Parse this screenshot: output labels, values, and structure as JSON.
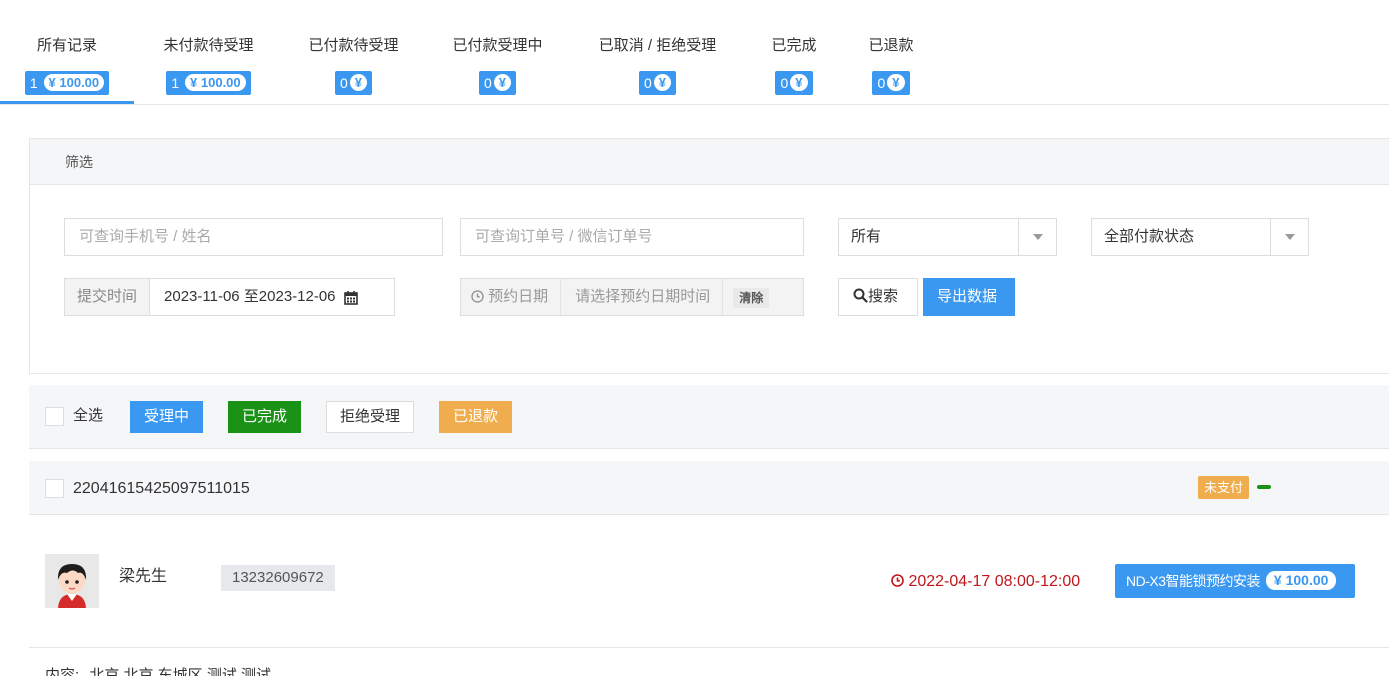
{
  "tabs": [
    {
      "label": "所有记录",
      "count": "1",
      "amount": "¥ 100.00",
      "active": true
    },
    {
      "label": "未付款待受理",
      "count": "1",
      "amount": "¥ 100.00",
      "active": false
    },
    {
      "label": "已付款待受理",
      "count": "0",
      "amount": "¥",
      "active": false
    },
    {
      "label": "已付款受理中",
      "count": "0",
      "amount": "¥",
      "active": false
    },
    {
      "label": "已取消 / 拒绝受理",
      "count": "0",
      "amount": "¥",
      "active": false
    },
    {
      "label": "已完成",
      "count": "0",
      "amount": "¥",
      "active": false
    },
    {
      "label": "已退款",
      "count": "0",
      "amount": "¥",
      "active": false
    }
  ],
  "filter": {
    "title": "筛选",
    "phone_placeholder": "可查询手机号 / 姓名",
    "order_placeholder": "可查询订单号 / 微信订单号",
    "select_all": "所有",
    "select_pay": "全部付款状态",
    "submit_time_label": "提交时间",
    "submit_time_value": "2023-11-06 至2023-12-06",
    "appoint_label": "预约日期",
    "appoint_placeholder": "请选择预约日期时间",
    "clear": "清除",
    "search": "搜索",
    "export": "导出数据"
  },
  "batch": {
    "select_all": "全选",
    "processing": "受理中",
    "done": "已完成",
    "reject": "拒绝受理",
    "refunded": "已退款"
  },
  "order": {
    "id": "22041615425097511015",
    "status": "未支付",
    "name": "梁先生",
    "phone": "13232609672",
    "appoint_time": "2022-04-17 08:00-12:00",
    "product": "ND-X3智能锁预约安装",
    "price": "¥ 100.00",
    "address_label": "内容:",
    "address": "北京 北京 东城区 测试 测试"
  },
  "colors": {
    "primary": "#3a98f0",
    "success": "#1a9216",
    "warning": "#f0ad4e",
    "danger": "#c0161b"
  }
}
